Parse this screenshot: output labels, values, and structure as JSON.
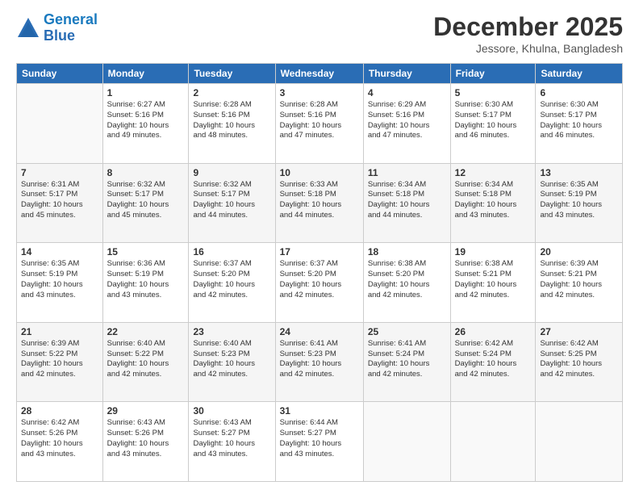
{
  "header": {
    "logo_line1": "General",
    "logo_line2": "Blue",
    "month_year": "December 2025",
    "location": "Jessore, Khulna, Bangladesh"
  },
  "days_of_week": [
    "Sunday",
    "Monday",
    "Tuesday",
    "Wednesday",
    "Thursday",
    "Friday",
    "Saturday"
  ],
  "weeks": [
    [
      {
        "day": "",
        "info": ""
      },
      {
        "day": "1",
        "info": "Sunrise: 6:27 AM\nSunset: 5:16 PM\nDaylight: 10 hours\nand 49 minutes."
      },
      {
        "day": "2",
        "info": "Sunrise: 6:28 AM\nSunset: 5:16 PM\nDaylight: 10 hours\nand 48 minutes."
      },
      {
        "day": "3",
        "info": "Sunrise: 6:28 AM\nSunset: 5:16 PM\nDaylight: 10 hours\nand 47 minutes."
      },
      {
        "day": "4",
        "info": "Sunrise: 6:29 AM\nSunset: 5:16 PM\nDaylight: 10 hours\nand 47 minutes."
      },
      {
        "day": "5",
        "info": "Sunrise: 6:30 AM\nSunset: 5:17 PM\nDaylight: 10 hours\nand 46 minutes."
      },
      {
        "day": "6",
        "info": "Sunrise: 6:30 AM\nSunset: 5:17 PM\nDaylight: 10 hours\nand 46 minutes."
      }
    ],
    [
      {
        "day": "7",
        "info": "Sunrise: 6:31 AM\nSunset: 5:17 PM\nDaylight: 10 hours\nand 45 minutes."
      },
      {
        "day": "8",
        "info": "Sunrise: 6:32 AM\nSunset: 5:17 PM\nDaylight: 10 hours\nand 45 minutes."
      },
      {
        "day": "9",
        "info": "Sunrise: 6:32 AM\nSunset: 5:17 PM\nDaylight: 10 hours\nand 44 minutes."
      },
      {
        "day": "10",
        "info": "Sunrise: 6:33 AM\nSunset: 5:18 PM\nDaylight: 10 hours\nand 44 minutes."
      },
      {
        "day": "11",
        "info": "Sunrise: 6:34 AM\nSunset: 5:18 PM\nDaylight: 10 hours\nand 44 minutes."
      },
      {
        "day": "12",
        "info": "Sunrise: 6:34 AM\nSunset: 5:18 PM\nDaylight: 10 hours\nand 43 minutes."
      },
      {
        "day": "13",
        "info": "Sunrise: 6:35 AM\nSunset: 5:19 PM\nDaylight: 10 hours\nand 43 minutes."
      }
    ],
    [
      {
        "day": "14",
        "info": "Sunrise: 6:35 AM\nSunset: 5:19 PM\nDaylight: 10 hours\nand 43 minutes."
      },
      {
        "day": "15",
        "info": "Sunrise: 6:36 AM\nSunset: 5:19 PM\nDaylight: 10 hours\nand 43 minutes."
      },
      {
        "day": "16",
        "info": "Sunrise: 6:37 AM\nSunset: 5:20 PM\nDaylight: 10 hours\nand 42 minutes."
      },
      {
        "day": "17",
        "info": "Sunrise: 6:37 AM\nSunset: 5:20 PM\nDaylight: 10 hours\nand 42 minutes."
      },
      {
        "day": "18",
        "info": "Sunrise: 6:38 AM\nSunset: 5:20 PM\nDaylight: 10 hours\nand 42 minutes."
      },
      {
        "day": "19",
        "info": "Sunrise: 6:38 AM\nSunset: 5:21 PM\nDaylight: 10 hours\nand 42 minutes."
      },
      {
        "day": "20",
        "info": "Sunrise: 6:39 AM\nSunset: 5:21 PM\nDaylight: 10 hours\nand 42 minutes."
      }
    ],
    [
      {
        "day": "21",
        "info": "Sunrise: 6:39 AM\nSunset: 5:22 PM\nDaylight: 10 hours\nand 42 minutes."
      },
      {
        "day": "22",
        "info": "Sunrise: 6:40 AM\nSunset: 5:22 PM\nDaylight: 10 hours\nand 42 minutes."
      },
      {
        "day": "23",
        "info": "Sunrise: 6:40 AM\nSunset: 5:23 PM\nDaylight: 10 hours\nand 42 minutes."
      },
      {
        "day": "24",
        "info": "Sunrise: 6:41 AM\nSunset: 5:23 PM\nDaylight: 10 hours\nand 42 minutes."
      },
      {
        "day": "25",
        "info": "Sunrise: 6:41 AM\nSunset: 5:24 PM\nDaylight: 10 hours\nand 42 minutes."
      },
      {
        "day": "26",
        "info": "Sunrise: 6:42 AM\nSunset: 5:24 PM\nDaylight: 10 hours\nand 42 minutes."
      },
      {
        "day": "27",
        "info": "Sunrise: 6:42 AM\nSunset: 5:25 PM\nDaylight: 10 hours\nand 42 minutes."
      }
    ],
    [
      {
        "day": "28",
        "info": "Sunrise: 6:42 AM\nSunset: 5:26 PM\nDaylight: 10 hours\nand 43 minutes."
      },
      {
        "day": "29",
        "info": "Sunrise: 6:43 AM\nSunset: 5:26 PM\nDaylight: 10 hours\nand 43 minutes."
      },
      {
        "day": "30",
        "info": "Sunrise: 6:43 AM\nSunset: 5:27 PM\nDaylight: 10 hours\nand 43 minutes."
      },
      {
        "day": "31",
        "info": "Sunrise: 6:44 AM\nSunset: 5:27 PM\nDaylight: 10 hours\nand 43 minutes."
      },
      {
        "day": "",
        "info": ""
      },
      {
        "day": "",
        "info": ""
      },
      {
        "day": "",
        "info": ""
      }
    ]
  ]
}
